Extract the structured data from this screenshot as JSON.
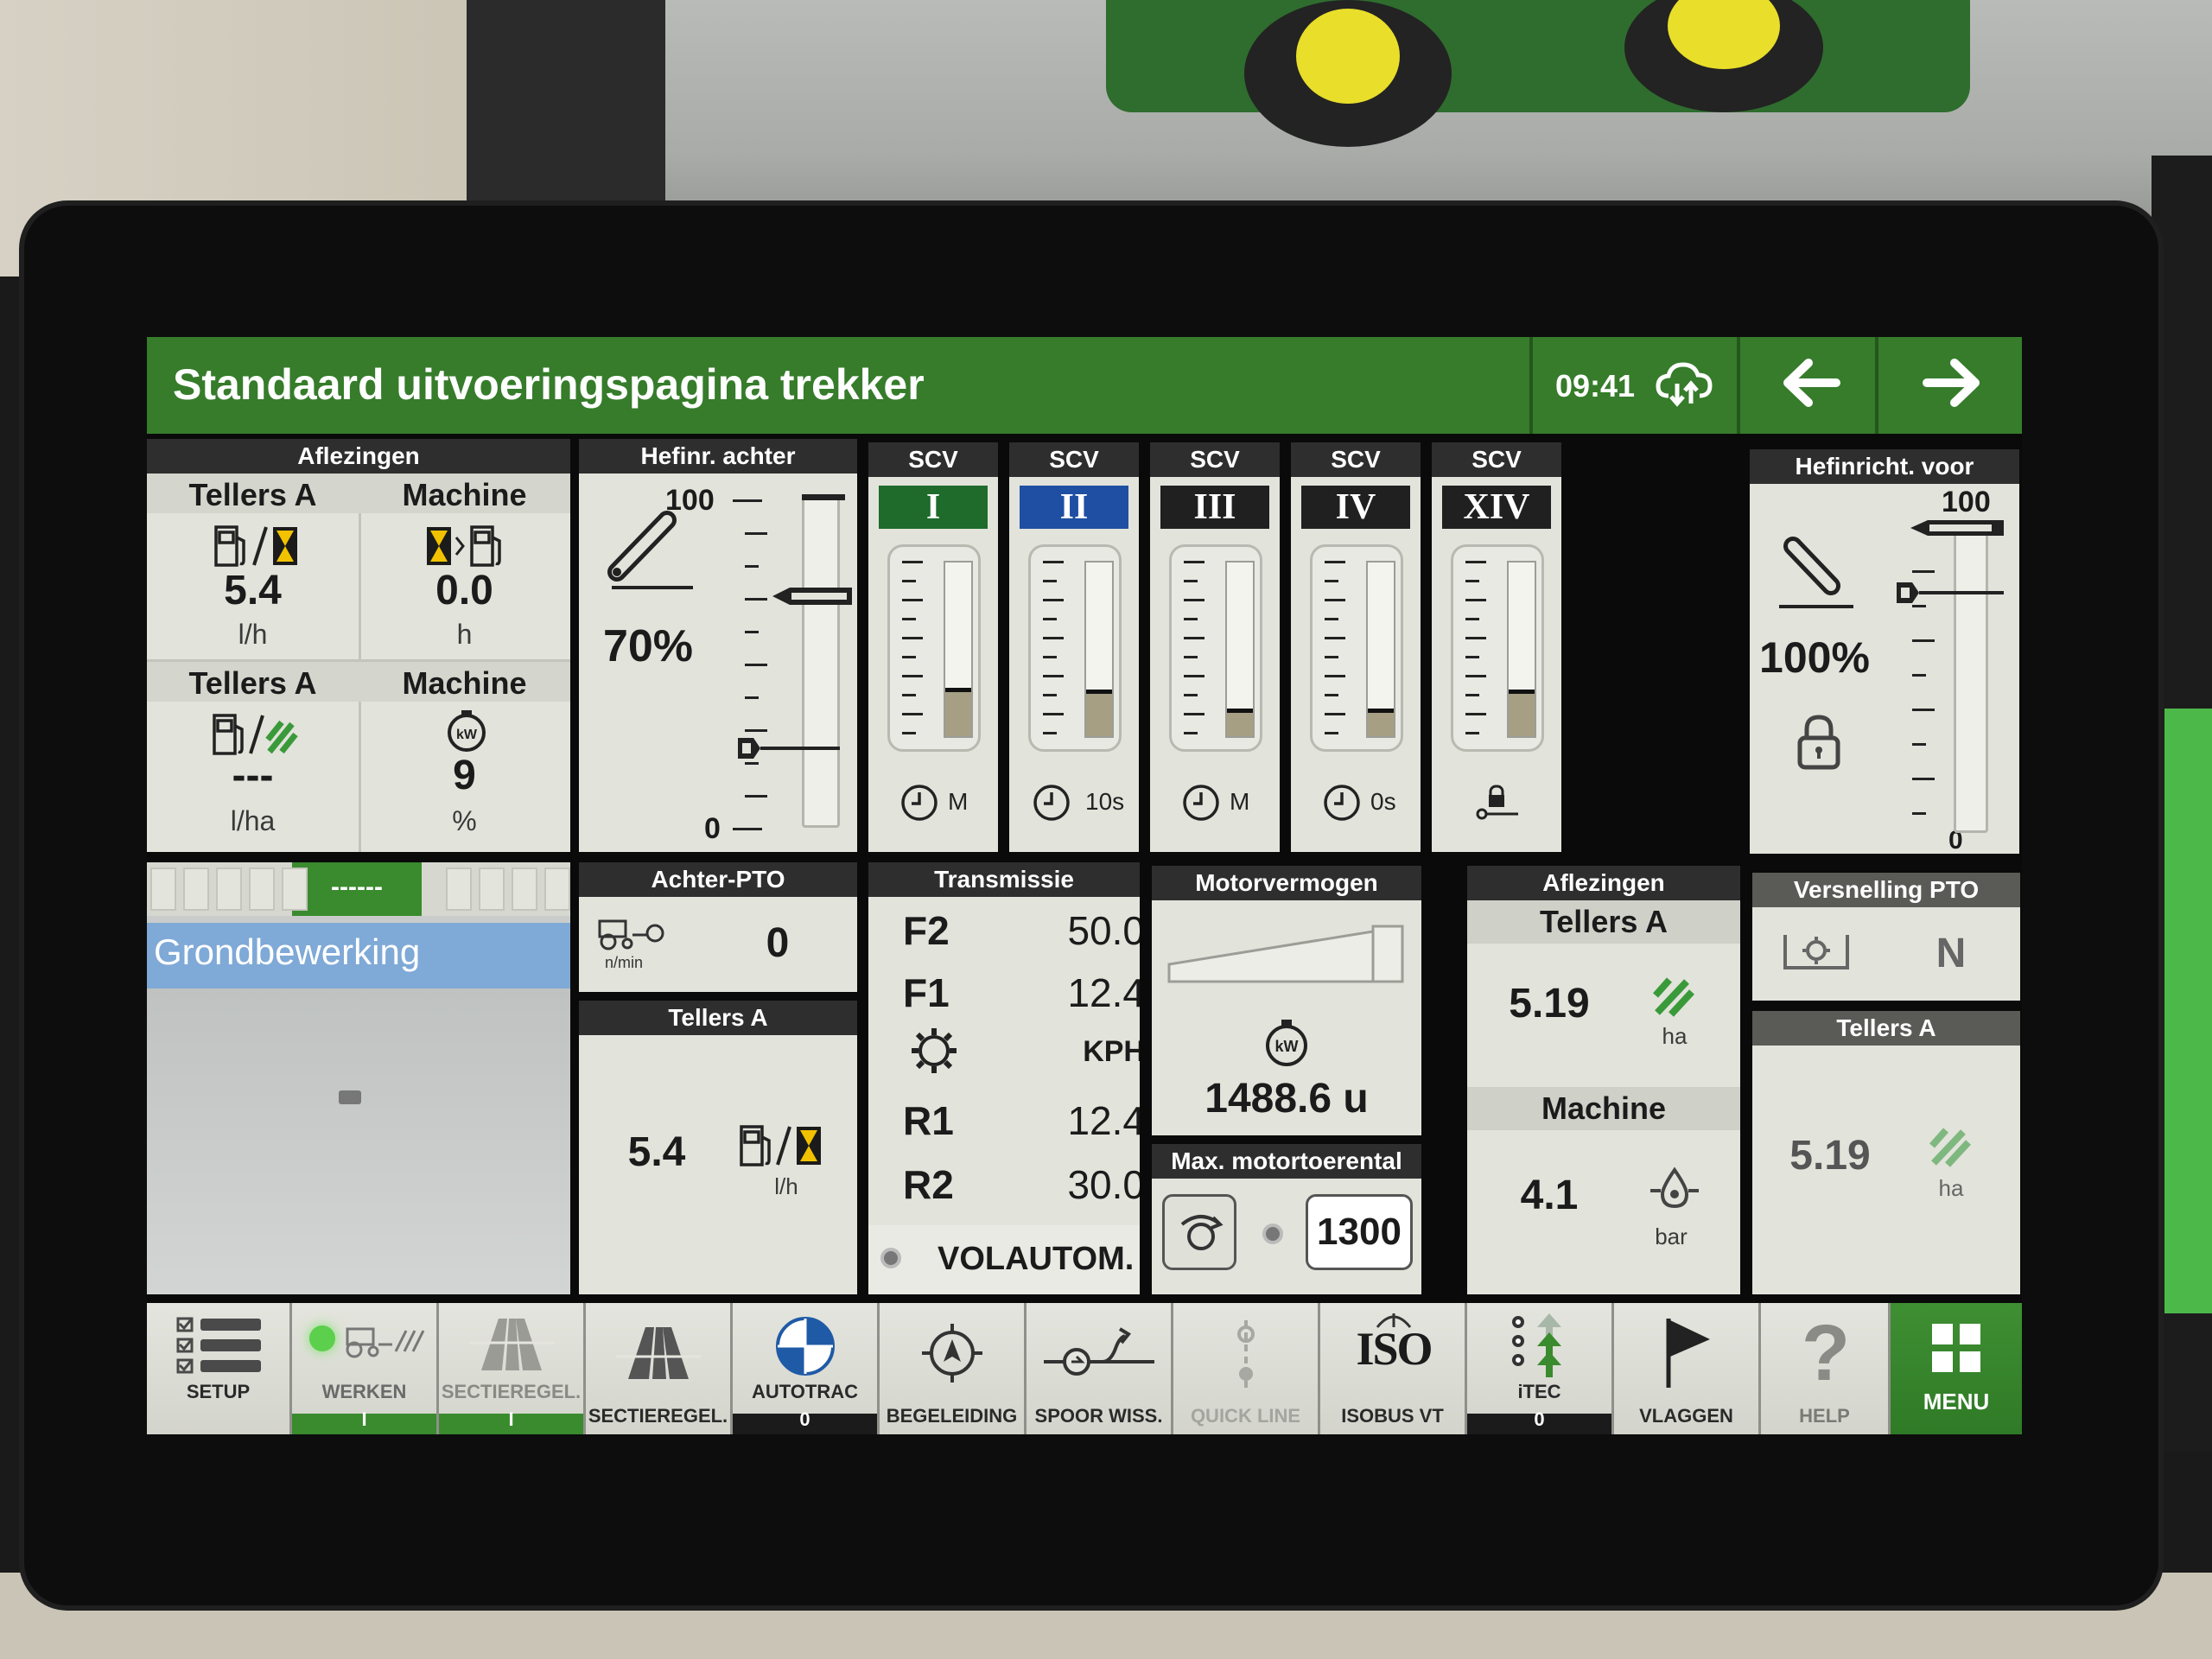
{
  "header": {
    "title": "Standaard uitvoeringspagina trekker",
    "time": "09:41"
  },
  "readings_a": {
    "title": "Aflezingen",
    "col1_label": "Tellers A",
    "col1_value": "5.4",
    "col1_unit": "l/h",
    "col2_label": "Machine",
    "col2_value": "0.0",
    "col2_unit": "h",
    "col3_label": "Tellers A",
    "col3_value": "---",
    "col3_unit": "l/ha",
    "col4_label": "Machine",
    "col4_value": "9",
    "col4_unit": "%"
  },
  "rear_hitch": {
    "title": "Hefinr. achter",
    "max": "100",
    "min": "0",
    "percent": "70%"
  },
  "scv": [
    {
      "title": "SCV",
      "roman": "I",
      "color": "#1e6b2b",
      "level": 0.28,
      "mode": "M"
    },
    {
      "title": "SCV",
      "roman": "II",
      "color": "#1f4fa3",
      "level": 0.27,
      "mode": "10s"
    },
    {
      "title": "SCV",
      "roman": "III",
      "color": "#202020",
      "level": 0.16,
      "mode": "M"
    },
    {
      "title": "SCV",
      "roman": "IV",
      "color": "#202020",
      "level": 0.16,
      "mode": "0s"
    },
    {
      "title": "SCV",
      "roman": "XIV",
      "color": "#202020",
      "level": 0.27,
      "mode": ""
    }
  ],
  "front_hitch": {
    "title": "Hefinricht. voor",
    "max": "100",
    "min": "0",
    "percent": "100%"
  },
  "guidance": {
    "dashes": "------",
    "label": "Grondbewerking"
  },
  "rear_pto": {
    "title": "Achter-PTO",
    "unit": "n/min",
    "value": "0"
  },
  "counter_a_left": {
    "title": "Tellers A",
    "value": "5.4",
    "unit": "l/h"
  },
  "transmission": {
    "title": "Transmissie",
    "rows": [
      {
        "gear": "F2",
        "value": "50.0"
      },
      {
        "gear": "F1",
        "value": "12.4"
      },
      {
        "gear": "",
        "value": "KPH"
      },
      {
        "gear": "R1",
        "value": "12.4"
      },
      {
        "gear": "R2",
        "value": "30.0"
      }
    ],
    "mode": "VOLAUTOM."
  },
  "engine_power": {
    "title": "Motorvermogen",
    "hours": "1488.6 u"
  },
  "max_rpm": {
    "title": "Max. motortoerental",
    "value": "1300"
  },
  "readings_b": {
    "title": "Aflezingen",
    "label1": "Tellers A",
    "value1": "5.19",
    "unit1": "ha",
    "label2": "Machine",
    "value2": "4.1",
    "unit2": "bar"
  },
  "pto_gear": {
    "title": "Versnelling PTO",
    "value": "N"
  },
  "counter_a_right": {
    "title": "Tellers A",
    "value": "5.19",
    "unit": "ha"
  },
  "toolbar": [
    {
      "label": "SETUP",
      "sub": ""
    },
    {
      "label": "WERKEN",
      "sub": "I"
    },
    {
      "label": "SECTIEREGEL.",
      "sub": "I"
    },
    {
      "label": "SECTIEREGEL.",
      "sub": ""
    },
    {
      "label": "AUTOTRAC",
      "sub": "0"
    },
    {
      "label": "BEGELEIDING",
      "sub": ""
    },
    {
      "label": "SPOOR WISS.",
      "sub": ""
    },
    {
      "label": "QUICK LINE",
      "sub": ""
    },
    {
      "label": "ISOBUS VT",
      "sub": ""
    },
    {
      "label": "iTEC",
      "sub": "0"
    },
    {
      "label": "VLAGGEN",
      "sub": ""
    },
    {
      "label": "HELP",
      "sub": ""
    },
    {
      "label": "MENU",
      "sub": ""
    }
  ],
  "iso_logo": "ISO"
}
